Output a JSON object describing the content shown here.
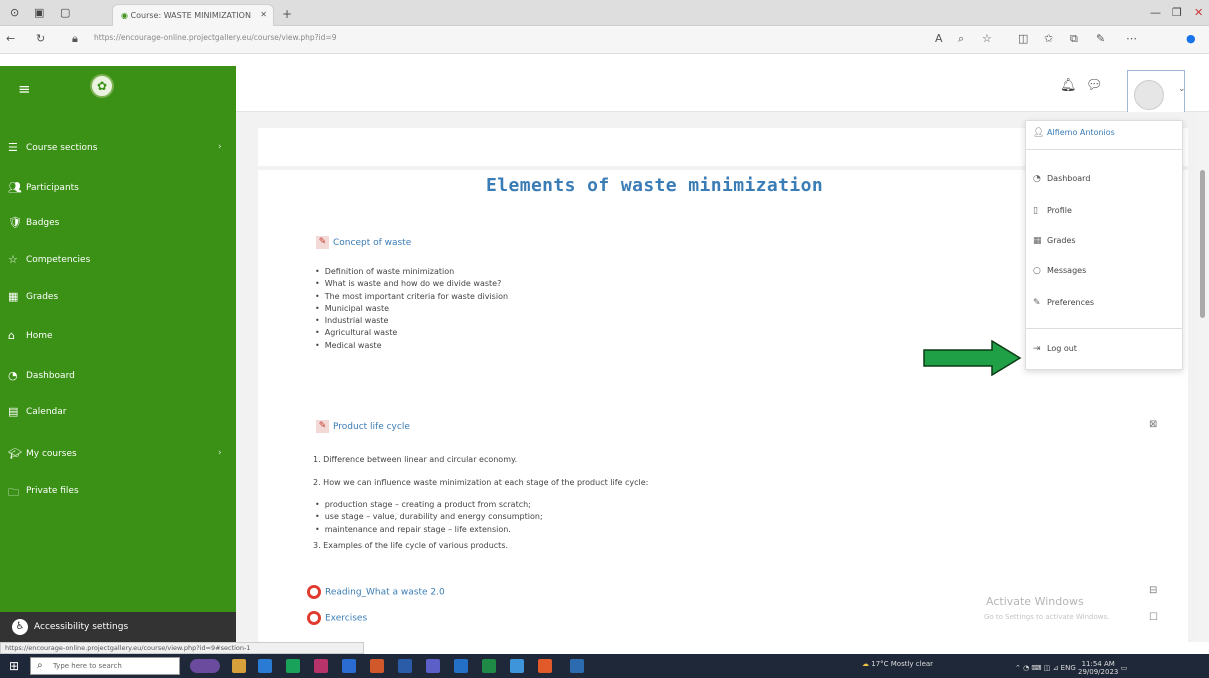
{
  "browser": {
    "tab_title": "Course: WASTE MINIMIZATION",
    "url": "https://encourage-online.projectgallery.eu/course/view.php?id=9",
    "status_url": "https://encourage-online.projectgallery.eu/course/view.php?id=9#section-1"
  },
  "sidebar": {
    "items": [
      {
        "label": "Course sections",
        "icon": "list-icon",
        "chevron": "›"
      },
      {
        "label": "Participants",
        "icon": "users-icon"
      },
      {
        "label": "Badges",
        "icon": "badge-icon"
      },
      {
        "label": "Competencies",
        "icon": "star-icon"
      },
      {
        "label": "Grades",
        "icon": "grades-icon"
      },
      {
        "label": "Home",
        "icon": "home-icon"
      },
      {
        "label": "Dashboard",
        "icon": "dashboard-icon"
      },
      {
        "label": "Calendar",
        "icon": "calendar-icon"
      },
      {
        "label": "My courses",
        "icon": "courses-icon",
        "chevron": "›"
      },
      {
        "label": "Private files",
        "icon": "files-icon"
      }
    ],
    "accessibility": "Accessibility settings"
  },
  "main": {
    "title": "Elements of waste minimization",
    "activity1": "Concept of waste",
    "list1": [
      "Definition of waste minimization",
      "What is waste and how do we divide waste?",
      "The most important criteria for waste division",
      "Municipal waste",
      "Industrial waste",
      "Agricultural waste",
      "Medical waste"
    ],
    "activity2": "Product life cycle",
    "para1": "1. Difference between linear and circular economy.",
    "para2": "2. How we can influence waste minimization at each stage of the product life cycle:",
    "list2": [
      "production stage – creating a product from scratch;",
      "use stage – value, durability and energy consumption;",
      "maintenance and repair stage – life extension."
    ],
    "para3": "3. Examples of the life cycle of various products.",
    "activity3": "Reading_What a waste 2.0",
    "activity4": "Exercises"
  },
  "user_menu": {
    "username": "Alfiemo Antonios",
    "items": [
      {
        "label": "Dashboard",
        "icon": "dashboard-icon"
      },
      {
        "label": "Profile",
        "icon": "profile-icon"
      },
      {
        "label": "Grades",
        "icon": "grades-icon"
      },
      {
        "label": "Messages",
        "icon": "messages-icon"
      },
      {
        "label": "Preferences",
        "icon": "preferences-icon"
      }
    ],
    "logout": "Log out"
  },
  "watermark": {
    "line1": "Activate Windows",
    "line2": "Go to Settings to activate Windows."
  },
  "taskbar": {
    "search_placeholder": "Type here to search",
    "weather": "17°C Mostly clear",
    "time": "11:54 AM",
    "date": "29/09/2023"
  },
  "colors": {
    "sidebar": "#3b9116",
    "title": "#3a7cb5",
    "arrow": "#1fa046"
  }
}
